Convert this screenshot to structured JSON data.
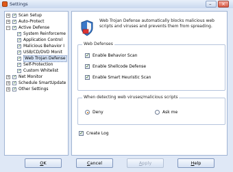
{
  "window": {
    "title": "Settings"
  },
  "tree": {
    "items": [
      {
        "label": "Scan Setup",
        "expander": "+",
        "checked": true
      },
      {
        "label": "Auto-Protect",
        "expander": "+",
        "checked": true
      },
      {
        "label": "Active Defense",
        "expander": "−",
        "checked": true
      },
      {
        "label": "System Reinforceme",
        "checked": true
      },
      {
        "label": "Application Control",
        "checked": true
      },
      {
        "label": "Malicious Behavior I",
        "checked": true
      },
      {
        "label": "USB/CD/DVD Monit",
        "checked": true
      },
      {
        "label": "Web Trojan Defense",
        "checked": true,
        "selected": true
      },
      {
        "label": "Self-Protection",
        "checked": true
      },
      {
        "label": "Custom Whitelist",
        "checked": true
      },
      {
        "label": "Net Monitor",
        "expander": "+",
        "checked": true
      },
      {
        "label": "Schedule SmartUpdate",
        "expander": "+",
        "checked": true
      },
      {
        "label": "Other Settings",
        "expander": "+",
        "checked": true
      }
    ]
  },
  "panel": {
    "description": "Web Trojan Defense automatically blocks malicious web scripts and viruses and prevents them from spreading.",
    "web_defenses": {
      "legend": "Web Defenses",
      "options": [
        {
          "label": "Enable Behavior Scan",
          "checked": true
        },
        {
          "label": "Enable Shellcode Defense",
          "checked": true
        },
        {
          "label": "Enable Smart Heuristic Scan",
          "checked": true
        }
      ]
    },
    "detection": {
      "legend": "When detecting web viruses/malicious scripts",
      "options": [
        {
          "label": "Deny",
          "selected": true
        },
        {
          "label": "Ask me",
          "selected": false
        }
      ]
    },
    "create_log": {
      "label": "Create Log",
      "checked": true
    }
  },
  "buttons": {
    "ok": {
      "mnemonic": "O",
      "rest": "K"
    },
    "cancel": {
      "mnemonic": "C",
      "rest": "ancel"
    },
    "apply": {
      "mnemonic": "A",
      "rest": "pply",
      "disabled": true
    },
    "help": {
      "mnemonic": "H",
      "rest": "elp"
    }
  },
  "colors": {
    "accent": "#d07a16",
    "window_bg": "#dfe8f6",
    "border": "#9fb3d3"
  },
  "icons": {
    "app": "app-icon",
    "shield": "shield-icon"
  }
}
